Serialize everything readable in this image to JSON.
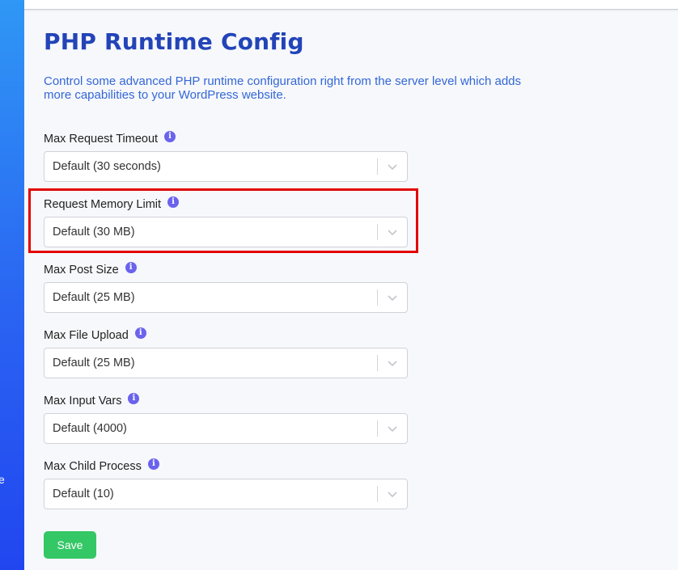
{
  "sidebar": {
    "fragment_text": "e"
  },
  "page": {
    "title": "PHP Runtime Config",
    "description": "Control some advanced PHP runtime configuration right from the server level which adds more capabilities to your WordPress website."
  },
  "fields": [
    {
      "label": "Max Request Timeout",
      "value": "Default (30 seconds)",
      "info_icon": "info-icon"
    },
    {
      "label": "Request Memory Limit",
      "value": "Default (30 MB)",
      "info_icon": "info-icon",
      "highlighted": true
    },
    {
      "label": "Max Post Size",
      "value": "Default (25 MB)",
      "info_icon": "info-icon"
    },
    {
      "label": "Max File Upload",
      "value": "Default (25 MB)",
      "info_icon": "info-icon"
    },
    {
      "label": "Max Input Vars",
      "value": "Default (4000)",
      "info_icon": "info-icon"
    },
    {
      "label": "Max Child Process",
      "value": "Default (10)",
      "info_icon": "info-icon"
    }
  ],
  "info_glyph": "i",
  "actions": {
    "save_label": "Save"
  },
  "colors": {
    "title": "#2344b8",
    "description": "#3367d6",
    "info_icon": "#6a63ee",
    "highlight": "#e30000",
    "save_button": "#34c766",
    "sidebar_top": "#2f97f5",
    "sidebar_bottom": "#2146f0"
  }
}
